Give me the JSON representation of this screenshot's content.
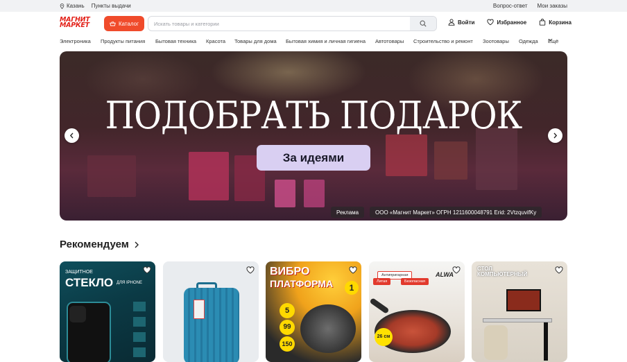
{
  "topbar": {
    "city": "Казань",
    "pickup": "Пункты выдачи",
    "faq": "Вопрос-ответ",
    "orders": "Мои заказы"
  },
  "header": {
    "logo_line1": "МАГНИТ",
    "logo_line2": "МАРКЕТ",
    "catalog_label": "Каталог",
    "search_placeholder": "Искать товары и категории",
    "login_label": "Войти",
    "favorites_label": "Избранное",
    "cart_label": "Корзина"
  },
  "categories": [
    "Электроника",
    "Продукты питания",
    "Бытовая техника",
    "Красота",
    "Товары для дома",
    "Бытовая химия и личная гигиена",
    "Автотовары",
    "Строительство и ремонт",
    "Зоотовары",
    "Одежда"
  ],
  "more_label": "Ещё",
  "banner": {
    "title": "ПОДОБРАТЬ ПОДАРОК",
    "button": "За идеями",
    "ad_label": "Реклама",
    "ad_info": "ООО «Магнит Маркет» ОГРН 1211600048791 Erid: 2VtzquvifKy"
  },
  "recommendations": {
    "title": "Рекомендуем",
    "products": [
      {
        "id": "glass",
        "line1": "ЗАЩИТНОЕ",
        "line2": "СТЕКЛО",
        "line3": "ДЛЯ IPHONE"
      },
      {
        "id": "suitcase"
      },
      {
        "id": "vibro",
        "line1": "ВИБРО",
        "line2": "ПЛАТФОРМА",
        "badge1": "5",
        "badge2": "99",
        "badge3": "150",
        "badge4": "1"
      },
      {
        "id": "pan",
        "tag1": "Антипригарная",
        "tag2": "Литая",
        "tag3": "Безопасная",
        "brand": "ALWA",
        "size": "26 см"
      },
      {
        "id": "desk",
        "line1": "СТОЛ",
        "line2": "КОМПЬЮТЕРНЫЙ"
      }
    ]
  },
  "colors": {
    "brand_red": "#e3231b",
    "catalog_button": "#f04b2b",
    "banner_button": "#d9cff2"
  }
}
